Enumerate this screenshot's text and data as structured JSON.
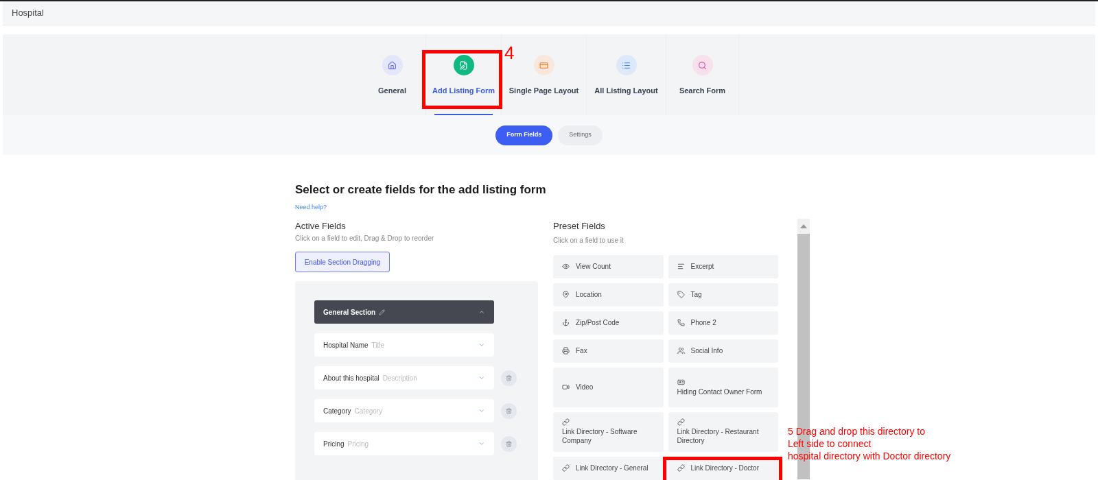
{
  "header": {
    "title": "Hospital"
  },
  "tabs": [
    {
      "label": "General",
      "selected": false,
      "highlighted": false
    },
    {
      "label": "Add Listing Form",
      "selected": true,
      "highlighted": true
    },
    {
      "label": "Single Page Layout",
      "selected": false,
      "highlighted": false
    },
    {
      "label": "All Listing Layout",
      "selected": false,
      "highlighted": false
    },
    {
      "label": "Search Form",
      "selected": false,
      "highlighted": false
    }
  ],
  "subtabs": [
    {
      "label": "Form Fields",
      "selected": true
    },
    {
      "label": "Settings",
      "selected": false
    }
  ],
  "form": {
    "title": "Select or create fields for the add listing form",
    "help_link": "Need help?"
  },
  "active_fields": {
    "title": "Active Fields",
    "subtitle": "Click on a field to edit, Drag & Drop to reorder",
    "button": "Enable Section Dragging",
    "section": {
      "title": "General Section",
      "expanded": true
    },
    "fields": [
      {
        "label": "Hospital Name",
        "type": "Title",
        "deletable": false
      },
      {
        "label": "About this hospital",
        "type": "Description",
        "deletable": true
      },
      {
        "label": "Category",
        "type": "Category",
        "deletable": true
      },
      {
        "label": "Pricing",
        "type": "Pricing",
        "deletable": true
      }
    ]
  },
  "preset_fields": {
    "title": "Preset Fields",
    "subtitle": "Click on a field to use it",
    "fields": [
      {
        "label": "View Count",
        "kind": "inline",
        "highlighted": false
      },
      {
        "label": "Excerpt",
        "kind": "inline",
        "highlighted": false
      },
      {
        "label": "Location",
        "kind": "inline",
        "highlighted": false
      },
      {
        "label": "Tag",
        "kind": "inline",
        "highlighted": false
      },
      {
        "label": "Zip/Post Code",
        "kind": "inline",
        "highlighted": false
      },
      {
        "label": "Phone 2",
        "kind": "inline",
        "highlighted": false
      },
      {
        "label": "Fax",
        "kind": "inline",
        "highlighted": false
      },
      {
        "label": "Social Info",
        "kind": "inline",
        "highlighted": false
      },
      {
        "label": "Video",
        "kind": "inline",
        "highlighted": false
      },
      {
        "label": "Hiding Contact Owner Form",
        "kind": "stacked",
        "highlighted": false
      },
      {
        "label": "Link Directory - Software Company",
        "kind": "stacked",
        "highlighted": false
      },
      {
        "label": "Link Directory - Restaurant Directory",
        "kind": "stacked",
        "highlighted": false
      },
      {
        "label": "Link Directory - General",
        "kind": "inline",
        "highlighted": false
      },
      {
        "label": "Link Directory - Doctor",
        "kind": "inline",
        "highlighted": true
      }
    ]
  },
  "annotations": {
    "step_4": "4",
    "step_5": [
      "5 Drag and drop this directory to",
      "Left side to connect",
      "hospital directory with Doctor directory"
    ]
  }
}
